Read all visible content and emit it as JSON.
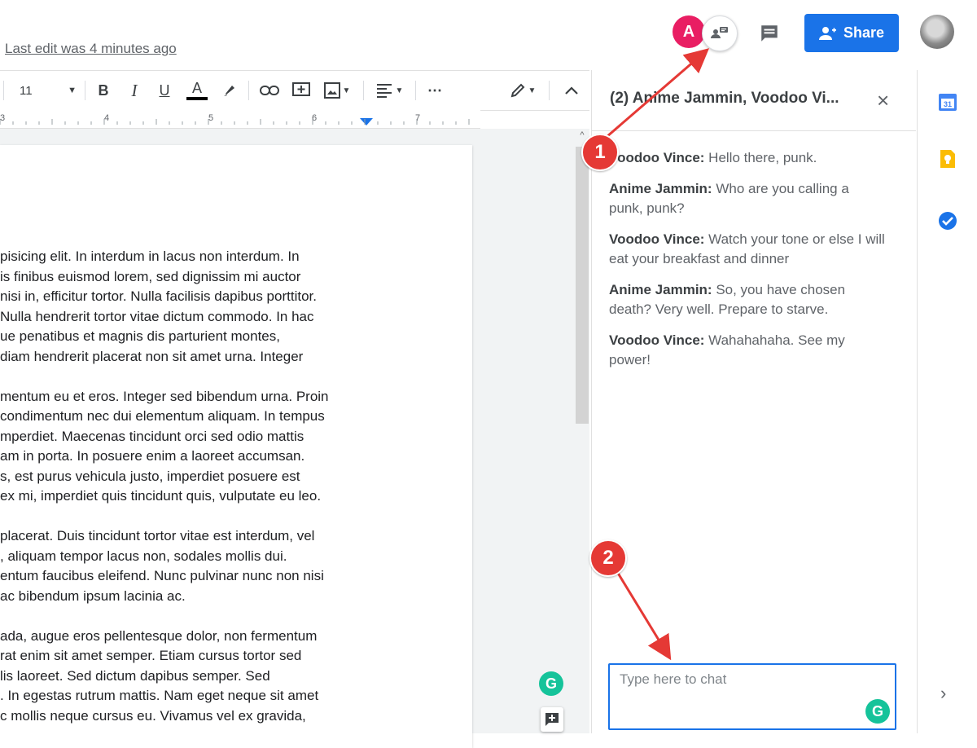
{
  "header": {
    "last_edit": "Last edit was 4 minutes ago",
    "avatar_letter": "A",
    "share_label": "Share",
    "colors": {
      "share": "#1a73e8",
      "avatar": "#e91e63"
    }
  },
  "toolbar": {
    "font_size": "11",
    "more": "⋯",
    "icons": [
      "bold-icon",
      "italic-icon",
      "underline-icon",
      "text-color-icon",
      "highlight-icon",
      "link-icon",
      "comment-icon",
      "image-icon",
      "align-icon",
      "more-icon",
      "edit-mode-icon",
      "collapse-icon"
    ]
  },
  "ruler": {
    "marks": [
      "3",
      "4",
      "5",
      "6",
      "7"
    ]
  },
  "document": {
    "paragraphs": [
      [
        "pisicing elit. In interdum in lacus non interdum. In",
        "is finibus euismod lorem, sed dignissim mi auctor",
        "nisi in, efficitur tortor. Nulla facilisis dapibus porttitor.",
        "Nulla hendrerit tortor vitae dictum commodo. In hac",
        "ue penatibus et magnis dis parturient montes,",
        " diam hendrerit placerat non sit amet urna. Integer"
      ],
      [
        "mentum eu et eros. Integer sed bibendum urna. Proin",
        "condimentum nec dui elementum aliquam. In tempus",
        "mperdiet. Maecenas tincidunt orci sed odio mattis",
        "am in porta. In posuere enim a laoreet accumsan.",
        "s, est purus vehicula justo, imperdiet posuere est",
        " ex mi, imperdiet quis tincidunt quis, vulputate eu leo."
      ],
      [
        "placerat. Duis tincidunt tortor vitae est interdum, vel",
        ", aliquam tempor lacus non, sodales mollis dui.",
        "entum faucibus eleifend. Nunc pulvinar nunc non nisi",
        " ac bibendum ipsum lacinia ac."
      ],
      [
        "ada, augue eros pellentesque dolor, non fermentum",
        "rat enim sit amet semper. Etiam cursus tortor sed",
        "lis laoreet. Sed dictum dapibus semper. Sed",
        ". In egestas rutrum mattis. Nam eget neque sit amet",
        "c mollis neque cursus eu. Vivamus vel ex gravida,"
      ]
    ]
  },
  "chat": {
    "title": "(2) Anime Jammin, Voodoo Vi...",
    "close": "×",
    "messages": [
      {
        "author": "Voodoo Vince:",
        "text": " Hello there, punk."
      },
      {
        "author": "Anime Jammin:",
        "text": " Who are you calling a punk, punk?"
      },
      {
        "author": "Voodoo Vince:",
        "text": " Watch your tone or else I will eat your breakfast and dinner"
      },
      {
        "author": "Anime Jammin:",
        "text": " So, you have chosen death? Very well. Prepare to starve."
      },
      {
        "author": "Voodoo Vince:",
        "text": " Wahahahaha. See my power!"
      }
    ],
    "input_placeholder": "Type here to chat",
    "grammarly": "G"
  },
  "side_panel": {
    "expand": "›"
  },
  "annotations": {
    "badge1": "1",
    "badge2": "2",
    "arrow_color": "#e53935"
  }
}
